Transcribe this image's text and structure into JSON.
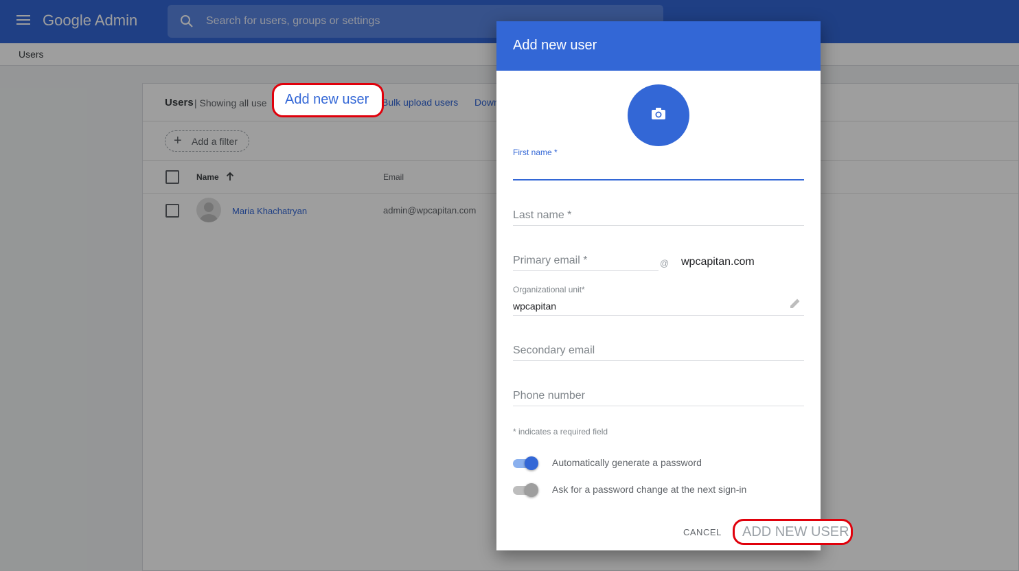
{
  "app": {
    "brand": "Google Admin",
    "search_placeholder": "Search for users, groups or settings"
  },
  "breadcrumb": {
    "current": "Users"
  },
  "users_card": {
    "title": "Users",
    "subtitle": "| Showing all use",
    "add_user_link": "Add new user",
    "bulk_upload_link": "Bulk upload users",
    "download_link": "Down",
    "add_filter": "Add a filter",
    "columns": {
      "name": "Name",
      "email": "Email"
    },
    "rows": [
      {
        "name": "Maria Khachatryan",
        "email": "admin@wpcapitan.com"
      }
    ]
  },
  "dialog": {
    "title": "Add new user",
    "first_name_label": "First name *",
    "first_name_value": "",
    "last_name_placeholder": "Last name *",
    "primary_email_placeholder": "Primary email *",
    "at_symbol": "@",
    "domain": "wpcapitan.com",
    "org_unit_label": "Organizational unit*",
    "org_unit_value": "wpcapitan",
    "secondary_email_placeholder": "Secondary email",
    "phone_placeholder": "Phone number",
    "required_note": "* indicates a required field",
    "toggles": [
      {
        "label": "Automatically generate a password",
        "on": true
      },
      {
        "label": "Ask for a password change at the next sign-in",
        "on": false
      }
    ],
    "cancel_label": "CANCEL",
    "submit_label": "ADD NEW USER"
  },
  "colors": {
    "primary": "#3367d6",
    "highlight": "#e0000b",
    "toggle_on_track": "#8ab0ee",
    "toggle_off_track": "#bdbdbd"
  }
}
